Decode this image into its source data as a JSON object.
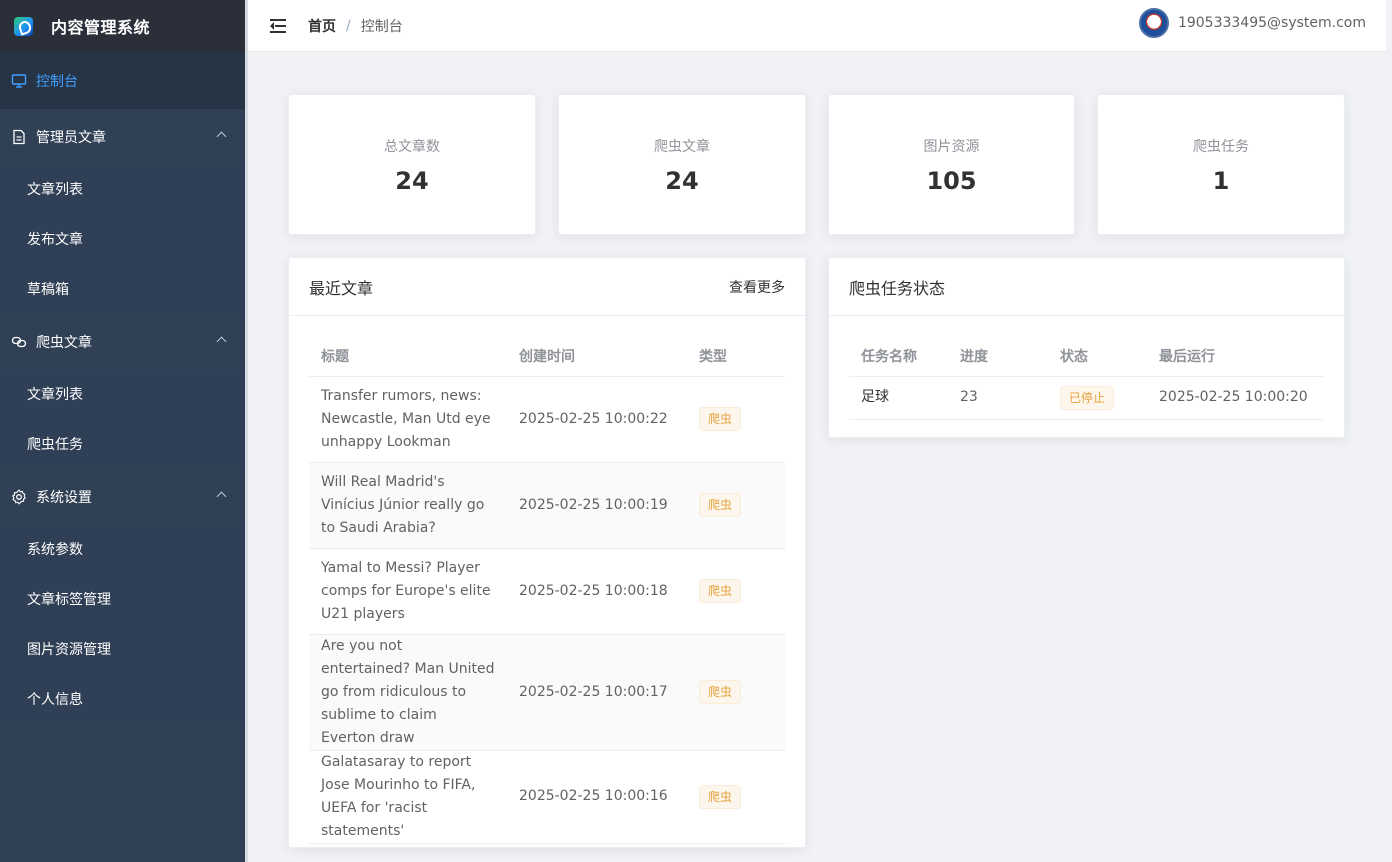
{
  "app": {
    "title": "内容管理系统"
  },
  "sidebar": {
    "dashboard": "控制台",
    "groups": [
      {
        "label": "管理员文章",
        "items": [
          "文章列表",
          "发布文章",
          "草稿箱"
        ]
      },
      {
        "label": "爬虫文章",
        "items": [
          "文章列表",
          "爬虫任务"
        ]
      },
      {
        "label": "系统设置",
        "items": [
          "系统参数",
          "文章标签管理",
          "图片资源管理",
          "个人信息"
        ]
      }
    ]
  },
  "header": {
    "breadcrumb_home": "首页",
    "breadcrumb_sep": "/",
    "breadcrumb_current": "控制台",
    "user_email": "1905333495@system.com"
  },
  "stats": [
    {
      "label": "总文章数",
      "value": "24"
    },
    {
      "label": "爬虫文章",
      "value": "24"
    },
    {
      "label": "图片资源",
      "value": "105"
    },
    {
      "label": "爬虫任务",
      "value": "1"
    }
  ],
  "recent": {
    "title": "最近文章",
    "more": "查看更多",
    "columns": [
      "标题",
      "创建时间",
      "类型"
    ],
    "rows": [
      {
        "title": "Transfer rumors, news: Newcastle, Man Utd eye unhappy Lookman",
        "time": "2025-02-25 10:00:22",
        "type": "爬虫"
      },
      {
        "title": "Will Real Madrid's Vinícius Júnior really go to Saudi Arabia?",
        "time": "2025-02-25 10:00:19",
        "type": "爬虫"
      },
      {
        "title": "Yamal to Messi? Player comps for Europe's elite U21 players",
        "time": "2025-02-25 10:00:18",
        "type": "爬虫"
      },
      {
        "title": "Are you not entertained? Man United go from ridiculous to sublime to claim Everton draw",
        "time": "2025-02-25 10:00:17",
        "type": "爬虫"
      },
      {
        "title": "Galatasaray to report Jose Mourinho to FIFA, UEFA for 'racist statements'",
        "time": "2025-02-25 10:00:16",
        "type": "爬虫"
      }
    ]
  },
  "crawler": {
    "title": "爬虫任务状态",
    "columns": [
      "任务名称",
      "进度",
      "状态",
      "最后运行"
    ],
    "rows": [
      {
        "name": "足球",
        "progress": "23",
        "status": "已停止",
        "last_run": "2025-02-25 10:00:20"
      }
    ]
  },
  "colors": {
    "sidebar_bg": "#304156",
    "active": "#409eff",
    "warning": "#e6a23c"
  }
}
